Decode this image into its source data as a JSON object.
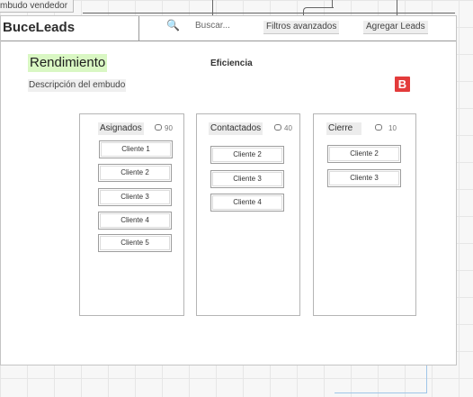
{
  "diagram": {
    "tag": "mbudo vendedor"
  },
  "header": {
    "brand": "BuceLeads",
    "search_placeholder": "Buscar...",
    "filters_button": "Filtros avanzados",
    "add_leads_button": "Agregar Leads"
  },
  "main": {
    "title": "Rendimiento",
    "description": "Descripción del embudo",
    "efficiency": "Eficiencia",
    "badge": "B"
  },
  "columns": [
    {
      "title": "Asignados",
      "count": "90",
      "cards": [
        "Cliente 1",
        "Cliente 2",
        "Cliente 3",
        "Cliente 4",
        "Cliente 5"
      ]
    },
    {
      "title": "Contactados",
      "count": "40",
      "cards": [
        "Cliente 2",
        "Cliente 3",
        "Cliente 4"
      ]
    },
    {
      "title": "Cierre",
      "count": "10",
      "cards": [
        "Cliente 2",
        "Cliente 3"
      ]
    }
  ]
}
